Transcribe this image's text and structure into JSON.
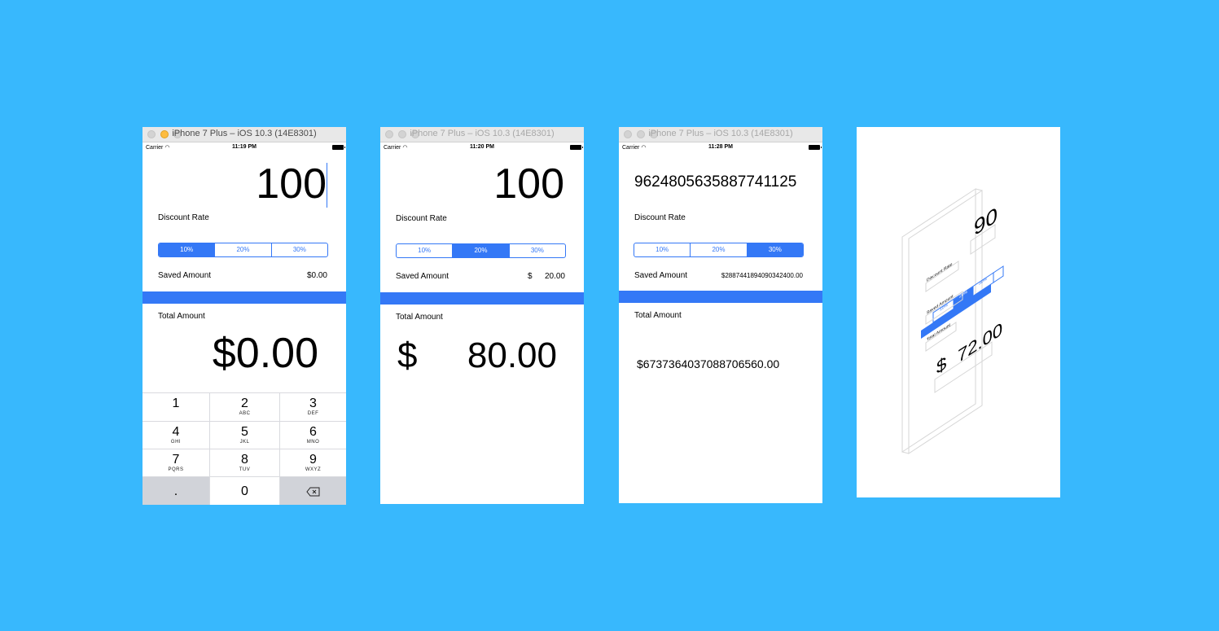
{
  "background_color": "#38b8fd",
  "accent_color": "#3478f6",
  "simulators": [
    {
      "window_title": "iPhone 7 Plus – iOS 10.3 (14E8301)",
      "status": {
        "carrier": "Carrier",
        "time": "11:19 PM"
      },
      "amount_input": "100",
      "discount_label": "Discount Rate",
      "segments": [
        "10%",
        "20%",
        "30%"
      ],
      "selected_segment": "10%",
      "saved_label": "Saved Amount",
      "saved_value": "$0.00",
      "total_label": "Total Amount",
      "total_value": "$0.00",
      "keypad": [
        {
          "num": "1",
          "sub": ""
        },
        {
          "num": "2",
          "sub": "ABC"
        },
        {
          "num": "3",
          "sub": "DEF"
        },
        {
          "num": "4",
          "sub": "GHI"
        },
        {
          "num": "5",
          "sub": "JKL"
        },
        {
          "num": "6",
          "sub": "MNO"
        },
        {
          "num": "7",
          "sub": "PQRS"
        },
        {
          "num": "8",
          "sub": "TUV"
        },
        {
          "num": "9",
          "sub": "WXYZ"
        },
        {
          "num": ".",
          "sub": ""
        },
        {
          "num": "0",
          "sub": ""
        },
        {
          "num": "",
          "sub": "",
          "icon": "backspace-icon"
        }
      ]
    },
    {
      "window_title": "iPhone 7 Plus – iOS 10.3 (14E8301)",
      "status": {
        "carrier": "Carrier",
        "time": "11:20 PM"
      },
      "amount_input": "100",
      "discount_label": "Discount Rate",
      "segments": [
        "10%",
        "20%",
        "30%"
      ],
      "selected_segment": "20%",
      "saved_label": "Saved Amount",
      "saved_currency": "$",
      "saved_value": "20.00",
      "total_label": "Total Amount",
      "total_currency": "$",
      "total_value": "80.00"
    },
    {
      "window_title": "iPhone 7 Plus – iOS 10.3 (14E8301)",
      "status": {
        "carrier": "Carrier",
        "time": "11:28 PM"
      },
      "amount_input": "9624805635887741125",
      "discount_label": "Discount Rate",
      "segments": [
        "10%",
        "20%",
        "30%"
      ],
      "selected_segment": "30%",
      "saved_label": "Saved Amount",
      "saved_value": "$2887441894090342400.00",
      "total_label": "Total Amount",
      "total_value": "$6737364037088706560.00"
    }
  ],
  "exploded_view": {
    "amount": "90",
    "segments": [
      "10%",
      "20%",
      "30%"
    ],
    "discount_label": "Discount Rate",
    "saved_label": "Saved Amount",
    "total_label": "Total Amount",
    "total_currency": "$",
    "total_value": "72.00"
  }
}
